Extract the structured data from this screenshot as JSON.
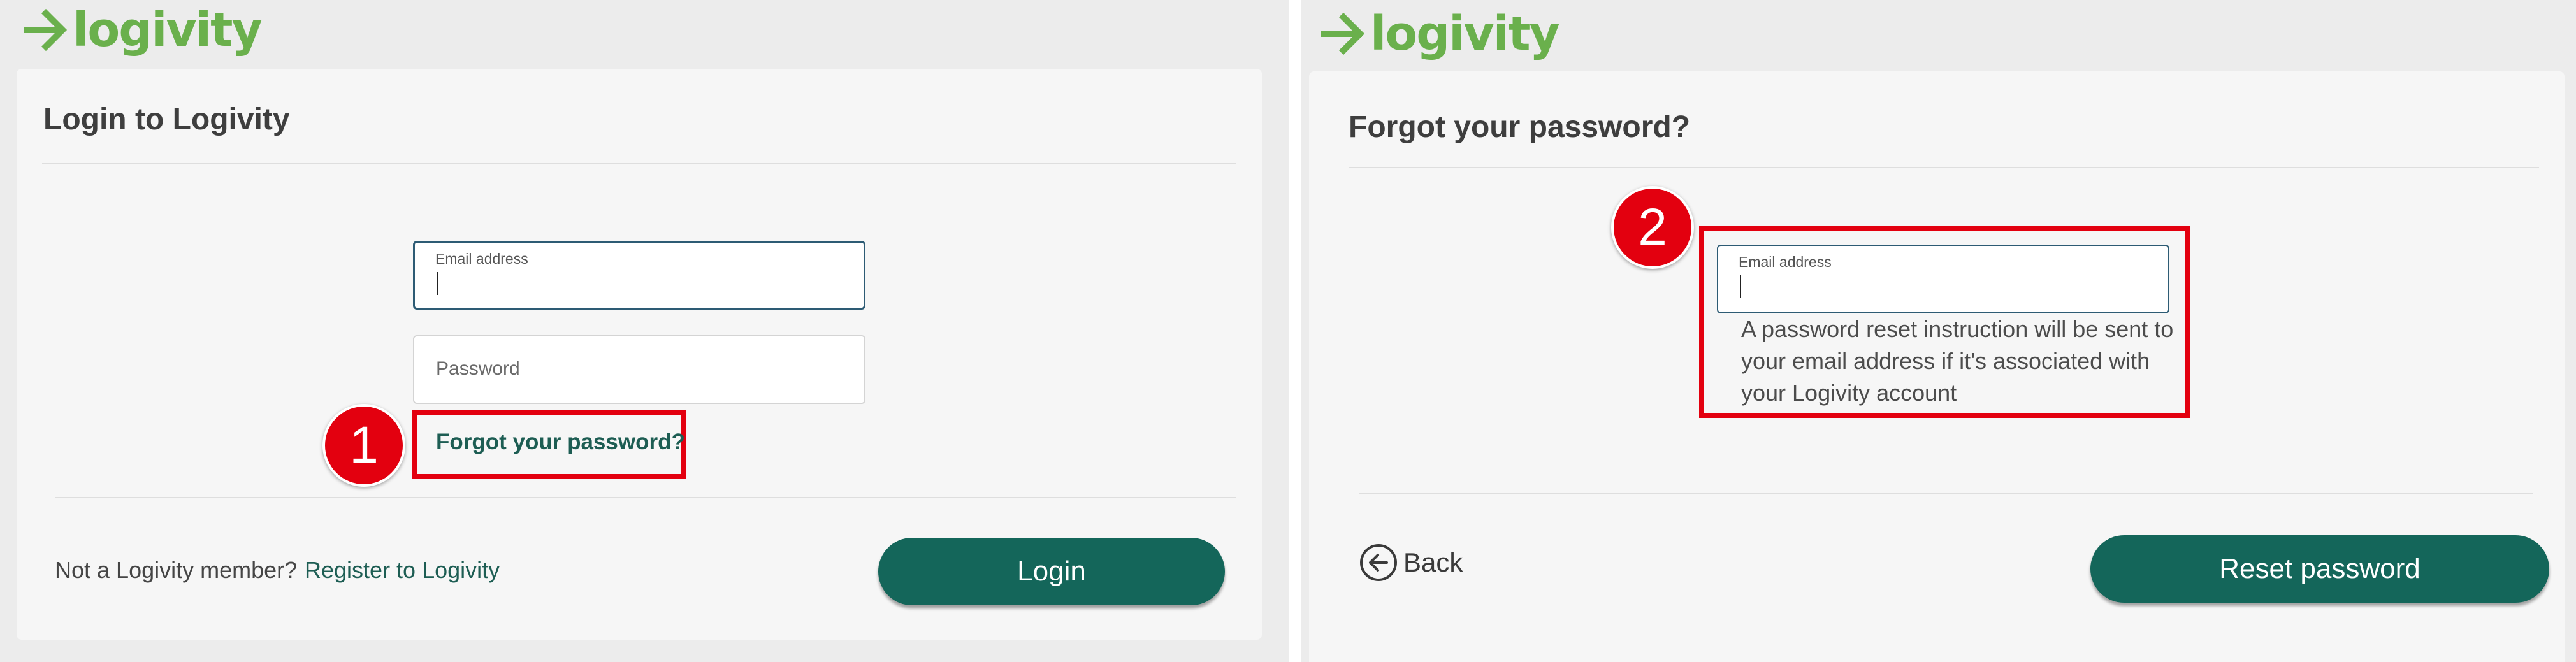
{
  "brand": {
    "name": "logivity",
    "logo_icon": "right-arrow-icon",
    "logo_color": "#6ab04c"
  },
  "colors": {
    "primary_button": "#14665a",
    "link": "#1d5d53",
    "annotation": "#e3000f",
    "focus_border": "#2d5b74"
  },
  "login_screen": {
    "title": "Login to Logivity",
    "email_field": {
      "label": "Email address",
      "value": ""
    },
    "password_field": {
      "placeholder": "Password",
      "value": ""
    },
    "forgot_link": "Forgot your password?",
    "member_prompt": "Not a Logivity member?",
    "register_link": "Register to Logivity",
    "login_button": "Login",
    "step_badge": "1"
  },
  "forgot_screen": {
    "title": "Forgot your password?",
    "email_field": {
      "label": "Email address",
      "value": ""
    },
    "help_text": "A password reset instruction will be sent to your email address if it's associated with your Logivity account",
    "back_link": "Back",
    "back_icon": "circle-left-arrow-icon",
    "reset_button": "Reset password",
    "step_badge": "2"
  }
}
